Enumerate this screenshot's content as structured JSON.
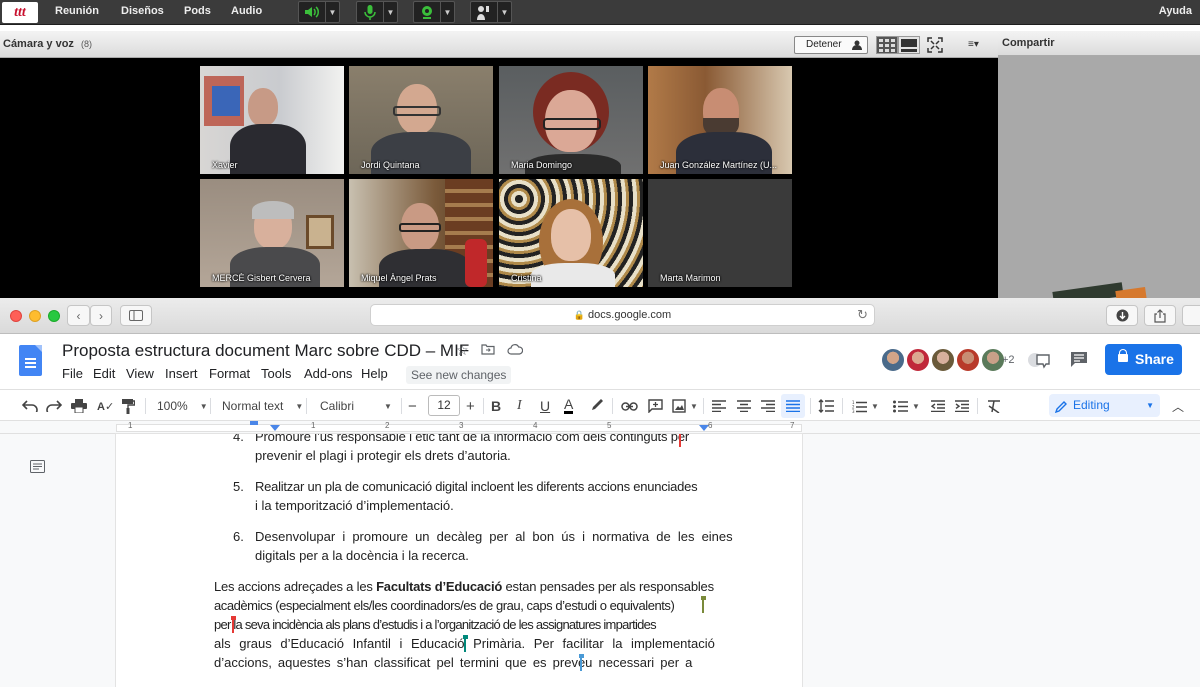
{
  "connect": {
    "logo": "ttt",
    "menu": [
      "Reunión",
      "Diseños",
      "Pods",
      "Audio"
    ],
    "help": "Ayuda",
    "camera_pod": {
      "title": "Cámara y voz",
      "count": "(8)",
      "stop_label": "Detener",
      "participants": [
        {
          "name": "Xavier"
        },
        {
          "name": "Jordi Quintana"
        },
        {
          "name": "Maria Domingo"
        },
        {
          "name": "Juan González Martínez (U..."
        },
        {
          "name": "MERCÈ Gisbert Cervera"
        },
        {
          "name": "Miquel Àngel Prats"
        },
        {
          "name": "Cristina"
        },
        {
          "name": "Marta Marimon"
        }
      ]
    },
    "share_pod": {
      "title": "Compartir"
    },
    "status_colors": {
      "active": "#3bbf3b",
      "bar": "#3b3b3b"
    }
  },
  "safari": {
    "url": "docs.google.com"
  },
  "docs": {
    "title": "Proposta estructura document Marc sobre CDD – MIF",
    "menu": [
      "File",
      "Edit",
      "View",
      "Insert",
      "Format",
      "Tools",
      "Add-ons",
      "Help"
    ],
    "see_changes": "See new changes",
    "more_collaborators": "+2",
    "share_label": "Share",
    "toolbar": {
      "zoom": "100%",
      "style": "Normal text",
      "font": "Calibri",
      "font_size": "12",
      "minus": "−",
      "plus": "+",
      "mode": "Editing"
    },
    "ruler_numbers": [
      "1",
      "1",
      "2",
      "3",
      "4",
      "5",
      "6",
      "7"
    ],
    "body": {
      "item4_num": "4.",
      "item4_line1": "Promoure l’ús responsable i ètic tant de la informació com dels continguts per",
      "item4_line2": "prevenir el plagi i protegir els drets d’autoria.",
      "item5_num": "5.",
      "item5_line1": "Realitzar un pla de comunicació digital incloent les diferents accions enunciades",
      "item5_line2": "i la temporització d’implementació.",
      "item6_num": "6.",
      "item6_line1": "Desenvolupar i promoure un decàleg per al bon ús i normativa de les eines",
      "item6_line2": "digitals per a la docència i la recerca.",
      "para_line1_a": "Les accions adreçades a les ",
      "para_line1_b": "Facultats d’Educació",
      "para_line1_c": " estan pensades per als responsables",
      "para_line2": "acadèmics (especialment els/les coordinadors/es de grau, caps d’estudi o equivalents)",
      "para_line3": "per la seva incidència als plans d’estudis i a l’organització de les assignatures impartides",
      "para_line4": "als graus d’Educació Infantil i Educació Primària. Per facilitar la implementació",
      "para_line5": "d’accions, aquestes s’han classificat pel termini que es preveu necessari per a"
    },
    "colors": {
      "accent": "#1a73e8",
      "docs_blue": "#4285f4"
    }
  }
}
